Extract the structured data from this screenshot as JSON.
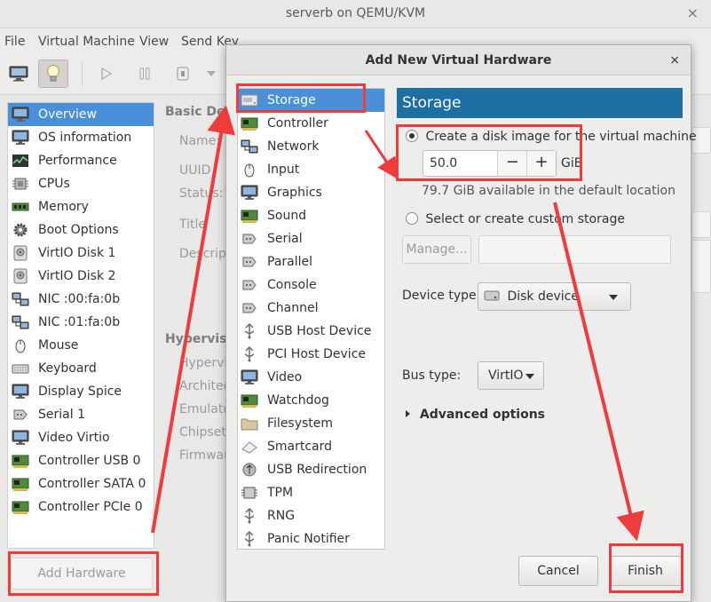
{
  "window": {
    "title": "serverb on QEMU/KVM",
    "close_glyph": "×"
  },
  "menu": [
    "File",
    "Virtual Machine",
    "View",
    "Send Key"
  ],
  "sidebar": {
    "items": [
      {
        "label": "Overview",
        "icon": "monitor-icon",
        "selected": true
      },
      {
        "label": "OS information",
        "icon": "monitor-icon"
      },
      {
        "label": "Performance",
        "icon": "performance-icon"
      },
      {
        "label": "CPUs",
        "icon": "cpu-icon"
      },
      {
        "label": "Memory",
        "icon": "memory-icon"
      },
      {
        "label": "Boot Options",
        "icon": "gear-icon"
      },
      {
        "label": "VirtIO Disk 1",
        "icon": "disk-icon"
      },
      {
        "label": "VirtIO Disk 2",
        "icon": "disk-icon"
      },
      {
        "label": "NIC :00:fa:0b",
        "icon": "network-icon"
      },
      {
        "label": "NIC :01:fa:0b",
        "icon": "network-icon"
      },
      {
        "label": "Mouse",
        "icon": "mouse-icon"
      },
      {
        "label": "Keyboard",
        "icon": "keyboard-icon"
      },
      {
        "label": "Display Spice",
        "icon": "monitor-icon"
      },
      {
        "label": "Serial 1",
        "icon": "serial-icon"
      },
      {
        "label": "Video Virtio",
        "icon": "monitor-icon"
      },
      {
        "label": "Controller USB 0",
        "icon": "card-icon"
      },
      {
        "label": "Controller SATA 0",
        "icon": "card-icon"
      },
      {
        "label": "Controller PCIe 0",
        "icon": "card-icon"
      }
    ],
    "add_hardware_label": "Add Hardware"
  },
  "details": {
    "basic_header": "Basic Deta",
    "fields": [
      "Name:",
      "UUID",
      "Status:",
      "Title",
      "Descript"
    ],
    "hypervisor_header": "Hyperviso",
    "hv_fields": [
      "Hypervis",
      "Architec",
      "Emulato",
      "Chipset:",
      "Firmwar"
    ]
  },
  "dialog": {
    "title": "Add New Virtual Hardware",
    "close_glyph": "×",
    "hardware_list": [
      {
        "label": "Storage",
        "icon": "storage-icon",
        "selected": true
      },
      {
        "label": "Controller",
        "icon": "card-icon"
      },
      {
        "label": "Network",
        "icon": "network-icon"
      },
      {
        "label": "Input",
        "icon": "mouse-icon"
      },
      {
        "label": "Graphics",
        "icon": "monitor-icon"
      },
      {
        "label": "Sound",
        "icon": "card-icon"
      },
      {
        "label": "Serial",
        "icon": "serial-icon"
      },
      {
        "label": "Parallel",
        "icon": "serial-icon"
      },
      {
        "label": "Console",
        "icon": "serial-icon"
      },
      {
        "label": "Channel",
        "icon": "serial-icon"
      },
      {
        "label": "USB Host Device",
        "icon": "usb-icon"
      },
      {
        "label": "PCI Host Device",
        "icon": "usb-icon"
      },
      {
        "label": "Video",
        "icon": "monitor-icon"
      },
      {
        "label": "Watchdog",
        "icon": "card-icon"
      },
      {
        "label": "Filesystem",
        "icon": "folder-icon"
      },
      {
        "label": "Smartcard",
        "icon": "smartcard-icon"
      },
      {
        "label": "USB Redirection",
        "icon": "usb-redirect-icon"
      },
      {
        "label": "TPM",
        "icon": "tpm-icon"
      },
      {
        "label": "RNG",
        "icon": "usb-icon"
      },
      {
        "label": "Panic Notifier",
        "icon": "usb-icon"
      }
    ],
    "panel": {
      "header": "Storage",
      "create_disk_label": "Create a disk image for the virtual machine",
      "disk_size": "50.0",
      "minus": "−",
      "plus": "+",
      "unit": "GiB",
      "available": "79.7 GiB available in the default location",
      "custom_storage_label": "Select or create custom storage",
      "manage_label": "Manage...",
      "device_type_label": "Device type:",
      "device_type_value": "Disk device",
      "bus_type_label": "Bus type:",
      "bus_type_value": "VirtIO",
      "advanced_label": "Advanced options"
    },
    "cancel_label": "Cancel",
    "finish_label": "Finish"
  },
  "colors": {
    "selection": "#4a90d9",
    "panel_header": "#1d6fa2",
    "annotation": "#ef3b3b"
  }
}
